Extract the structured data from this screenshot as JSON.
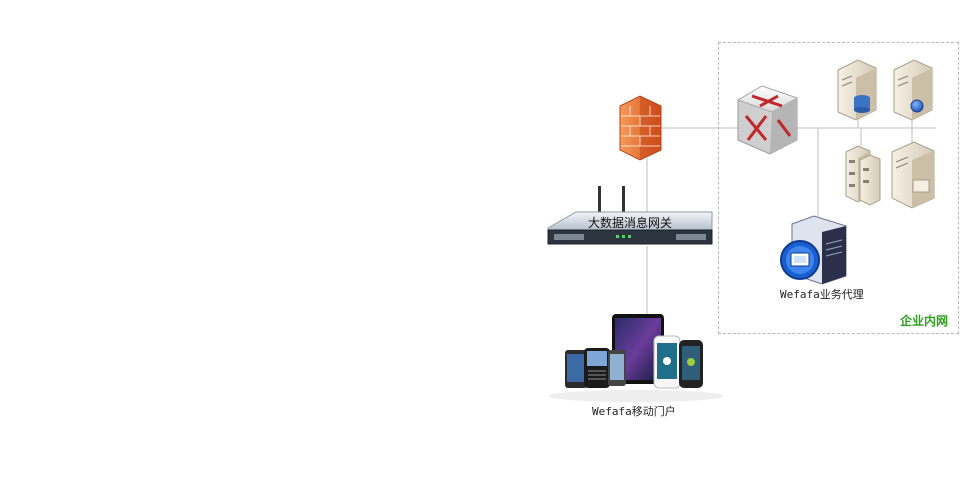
{
  "diagram": {
    "gateway": {
      "label": "大数据消息网关"
    },
    "proxy": {
      "label": "Wefafa业务代理"
    },
    "portal": {
      "label": "Wefafa移动门户"
    },
    "enterprise": {
      "label": "企业内网"
    }
  },
  "colors": {
    "firewall": "#e8692a",
    "router_red": "#c0282a",
    "enterprise_label": "#2ea01e",
    "link_line": "#bdbdbd"
  }
}
